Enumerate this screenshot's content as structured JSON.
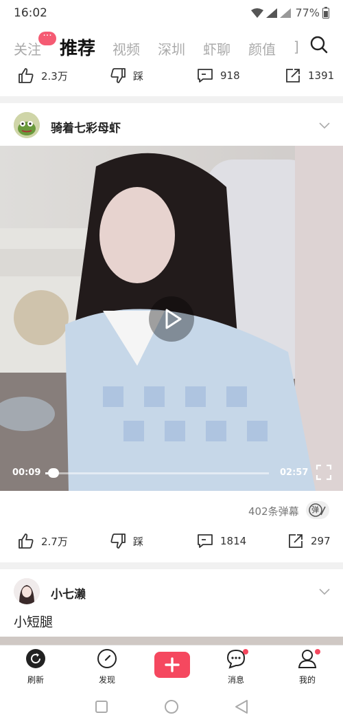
{
  "status": {
    "time": "16:02",
    "battery": "77%"
  },
  "tabs": [
    "关注",
    "推荐",
    "视频",
    "深圳",
    "虾聊",
    "颜值",
    "]"
  ],
  "tab_badge": "···",
  "first_post_actions": {
    "likes": "2.3万",
    "dislike": "踩",
    "comments": "918",
    "shares": "1391"
  },
  "post": {
    "author": "骑着七彩母虾",
    "video": {
      "current_time": "00:09",
      "duration": "02:57",
      "progress": 0.05
    },
    "danmu_count": "402条弹幕",
    "danmu_toggle": "弹",
    "actions": {
      "likes": "2.7万",
      "dislike": "踩",
      "comments": "1814",
      "shares": "297"
    }
  },
  "next_post": {
    "author": "小七濑",
    "caption": "小短腿"
  },
  "bottom_nav": [
    {
      "label": "刷新",
      "icon": "refresh-icon"
    },
    {
      "label": "发现",
      "icon": "compass-icon"
    },
    {
      "label": "",
      "icon": "plus-icon"
    },
    {
      "label": "消息",
      "icon": "message-icon"
    },
    {
      "label": "我的",
      "icon": "profile-icon"
    }
  ],
  "colors": {
    "accent": "#f5485f",
    "tab_inactive": "#aaaaaa"
  }
}
